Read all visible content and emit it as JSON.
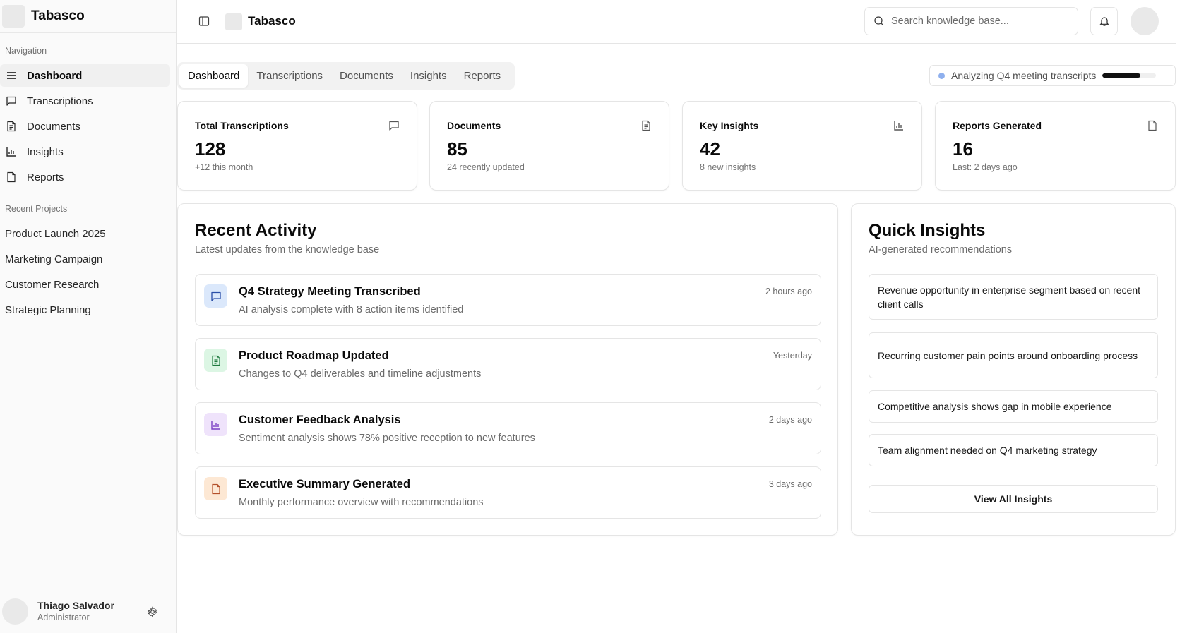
{
  "app": {
    "name": "Tabasco"
  },
  "sidebar": {
    "nav_label": "Navigation",
    "items": [
      {
        "label": "Dashboard",
        "icon": "menu-icon"
      },
      {
        "label": "Transcriptions",
        "icon": "message-icon"
      },
      {
        "label": "Documents",
        "icon": "file-text-icon"
      },
      {
        "label": "Insights",
        "icon": "bar-chart-icon"
      },
      {
        "label": "Reports",
        "icon": "file-icon"
      }
    ],
    "projects_label": "Recent Projects",
    "projects": [
      "Product Launch 2025",
      "Marketing Campaign",
      "Customer Research",
      "Strategic Planning"
    ],
    "user": {
      "name": "Thiago Salvador",
      "role": "Administrator"
    }
  },
  "header": {
    "title": "Tabasco",
    "search_placeholder": "Search knowledge base..."
  },
  "tabs": [
    "Dashboard",
    "Transcriptions",
    "Documents",
    "Insights",
    "Reports"
  ],
  "status": {
    "text": "Analyzing Q4 meeting transcripts",
    "progress": 0.7,
    "dot_color": "#8fb0ee"
  },
  "stats": [
    {
      "title": "Total Transcriptions",
      "value": "128",
      "sub": "+12 this month",
      "icon": "message-icon"
    },
    {
      "title": "Documents",
      "value": "85",
      "sub": "24 recently updated",
      "icon": "file-text-icon"
    },
    {
      "title": "Key Insights",
      "value": "42",
      "sub": "8 new insights",
      "icon": "bar-chart-icon"
    },
    {
      "title": "Reports Generated",
      "value": "16",
      "sub": "Last: 2 days ago",
      "icon": "file-icon"
    }
  ],
  "activity": {
    "title": "Recent Activity",
    "subtitle": "Latest updates from the knowledge base",
    "items": [
      {
        "title": "Q4 Strategy Meeting Transcribed",
        "desc": "AI analysis complete with 8 action items identified",
        "time": "2 hours ago",
        "bg": "#dbe8fb",
        "fg": "#2b4fa8"
      },
      {
        "title": "Product Roadmap Updated",
        "desc": "Changes to Q4 deliverables and timeline adjustments",
        "time": "Yesterday",
        "bg": "#dcf6e4",
        "fg": "#1f7a3f"
      },
      {
        "title": "Customer Feedback Analysis",
        "desc": "Sentiment analysis shows 78% positive reception to new features",
        "time": "2 days ago",
        "bg": "#efe3fb",
        "fg": "#7b3fc4"
      },
      {
        "title": "Executive Summary Generated",
        "desc": "Monthly performance overview with recommendations",
        "time": "3 days ago",
        "bg": "#fde8d4",
        "fg": "#b4502a"
      }
    ]
  },
  "insights": {
    "title": "Quick Insights",
    "subtitle": "AI-generated recommendations",
    "items": [
      "Revenue opportunity in enterprise segment based on recent client calls",
      "Recurring customer pain points around onboarding process",
      "Competitive analysis shows gap in mobile experience",
      "Team alignment needed on Q4 marketing strategy"
    ],
    "button": "View All Insights"
  }
}
